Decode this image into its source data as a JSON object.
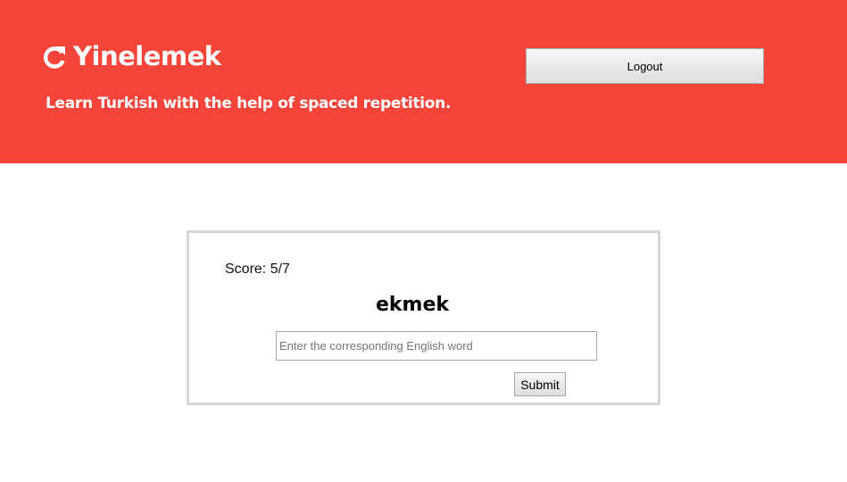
{
  "header": {
    "brand_icon": "refresh-icon",
    "brand_title": "Yinelemek",
    "tagline": "Learn Turkish with the help of spaced repetition.",
    "logout_label": "Logout",
    "background_color": "#f5443a"
  },
  "quiz": {
    "score_label": "Score: 5/7",
    "word": "ekmek",
    "answer_value": "",
    "answer_placeholder": "Enter the corresponding English word",
    "submit_label": "Submit"
  }
}
